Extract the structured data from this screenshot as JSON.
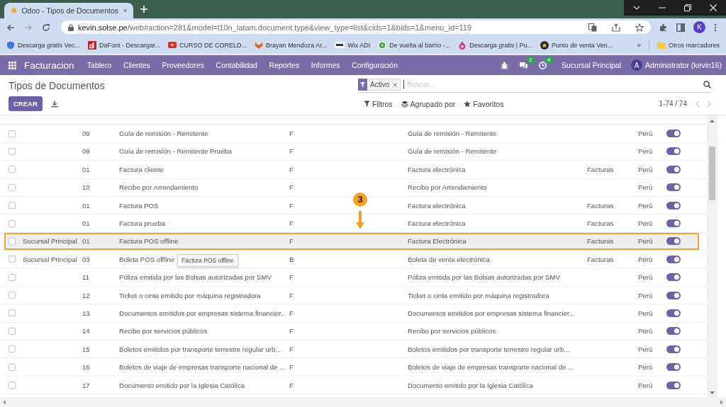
{
  "browser": {
    "tab": {
      "title": "Odoo - Tipos de Documentos"
    },
    "url": {
      "host": "kevin.solse.pe",
      "path": "/web#action=281&model=l10n_latam.document.type&view_type=list&cids=1&bids=1&menu_id=119"
    },
    "profile_initial": "K",
    "bookmarks": [
      {
        "label": "Descarga gratis Vec...",
        "kind": "shield"
      },
      {
        "label": "DaFont - Descargar...",
        "kind": "tile"
      },
      {
        "label": "CURSO DE CORELD...",
        "kind": "video"
      },
      {
        "label": "Brayan Mendoza Ar...",
        "kind": "fox"
      },
      {
        "label": "Wix ADI",
        "kind": "wix"
      },
      {
        "label": "De vuelta al barrio -...",
        "kind": "play"
      },
      {
        "label": "Descarga gratis | Pu...",
        "kind": "flame"
      },
      {
        "label": "Punto de venta Ven...",
        "kind": "badge"
      }
    ],
    "more_bookmarks": "»",
    "other_bookmarks": "Otros marcadores"
  },
  "navbar": {
    "app": "Facturacion",
    "menu": [
      "Tablero",
      "Clientes",
      "Proveedores",
      "Contabilidad",
      "Reportes",
      "Informes",
      "Configuración"
    ],
    "messages_badge": "2",
    "activities_badge": "4",
    "company": "Sucursal Principal",
    "user_initial": "A",
    "user": "Administrator (kevin16)"
  },
  "control_panel": {
    "title": "Tipos de Documentos",
    "create_button": "CREAR",
    "search": {
      "facets": [
        "Activo"
      ],
      "placeholder": "Buscar..."
    },
    "search_options": [
      {
        "label": "Filtros",
        "kind": "filter"
      },
      {
        "label": "Agrupado por",
        "kind": "group"
      },
      {
        "label": "Favoritos",
        "kind": "favorite"
      }
    ],
    "pager": "1-74 / 74"
  },
  "table": {
    "rows": [
      {
        "checked": false,
        "column_3": "09",
        "column_4": "Guía de remisión - Remitente",
        "column_5": "F",
        "column_6": "Guía de remisión - Remitente",
        "column_8": "Perú",
        "on": true,
        "highlighted": false
      },
      {
        "checked": false,
        "column_3": "09",
        "column_4": "Guía de remisión - Remitente Prueba",
        "column_5": "F",
        "column_6": "Guía de remisión - Remitente",
        "column_8": "Perú",
        "on": true,
        "highlighted": false
      },
      {
        "checked": false,
        "column_3": "01",
        "column_4": "Factura cliente",
        "column_5": "F",
        "column_6": "Factura electrónica",
        "column_7": "Facturas",
        "column_8": "Perú",
        "on": true,
        "highlighted": false
      },
      {
        "checked": false,
        "column_3": "10",
        "column_4": "Recibo por Arrendamiento",
        "column_5": "F",
        "column_6": "Recibo por Arrendamiento",
        "column_8": "Perú",
        "on": true,
        "highlighted": false
      },
      {
        "checked": false,
        "column_3": "01",
        "column_4": "Factura POS",
        "column_5": "F",
        "column_6": "Factura electrónica",
        "column_7": "Facturas",
        "column_8": "Perú",
        "on": true,
        "highlighted": false
      },
      {
        "checked": false,
        "column_3": "01",
        "column_4": "Factura prueba",
        "column_5": "F",
        "column_6": "Factura electrónica",
        "column_7": "Facturas",
        "column_8": "Perú",
        "on": true,
        "highlighted": false
      },
      {
        "checked": false,
        "column_2": "Sucursal Principal",
        "column_3": "01",
        "column_4": "Factura POS offline",
        "column_5": "F",
        "column_6": "Factura Electrónica",
        "column_7": "Facturas",
        "column_8": "Perú",
        "on": true,
        "highlighted": true,
        "callout": "3",
        "tooltip": "Factura POS offline"
      },
      {
        "checked": false,
        "column_2": "Sucursal Principal",
        "column_3": "03",
        "column_4": "Boleta POS offline",
        "column_5": "B",
        "column_6": "Boleta de venta electrónica",
        "column_7": "Facturas",
        "column_8": "Perú",
        "on": true,
        "highlighted": false
      },
      {
        "checked": false,
        "column_3": "11",
        "column_4": "Póliza emitida por las Bolsas autorizadas por SMV",
        "column_5": "F",
        "column_6": "Póliza emitida por las Bolsas autorizadas por SMV",
        "column_8": "Perú",
        "on": true,
        "highlighted": false
      },
      {
        "checked": false,
        "column_3": "12",
        "column_4": "Ticket o cinta emitido por máquina registradora",
        "column_5": "F",
        "column_6": "Ticket o cinta emitido por máquina registradora",
        "column_8": "Perú",
        "on": true,
        "highlighted": false
      },
      {
        "checked": false,
        "column_3": "13",
        "column_4": "Documentos emitidos por empresas sistema financier...",
        "column_5": "F",
        "column_6": "Documentos emitidos por empresas sistema financier...",
        "column_8": "Perú",
        "on": true,
        "highlighted": false
      },
      {
        "checked": false,
        "column_3": "14",
        "column_4": "Recibo por servicios públicos",
        "column_5": "F",
        "column_6": "Recibo por servicios públicos",
        "column_8": "Perú",
        "on": true,
        "highlighted": false
      },
      {
        "checked": false,
        "column_3": "15",
        "column_4": "Boletos emitidos por transporte terrestre regular urb...",
        "column_5": "F",
        "column_6": "Boletos emitidos por transporte terrestre regular urb...",
        "column_8": "Perú",
        "on": true,
        "highlighted": false
      },
      {
        "checked": false,
        "column_3": "16",
        "column_4": "Boletos de viaje de empresas transporte nacional de ...",
        "column_5": "F",
        "column_6": "Boletos de viaje de empresas transporte nacional de ...",
        "column_8": "Perú",
        "on": true,
        "highlighted": false
      },
      {
        "checked": false,
        "column_3": "17",
        "column_4": "Documento emitido por la Iglesia Católica",
        "column_5": "F",
        "column_6": "Documento emitido por la Iglesia Católica",
        "column_8": "Perú",
        "on": true,
        "highlighted": false
      }
    ]
  }
}
